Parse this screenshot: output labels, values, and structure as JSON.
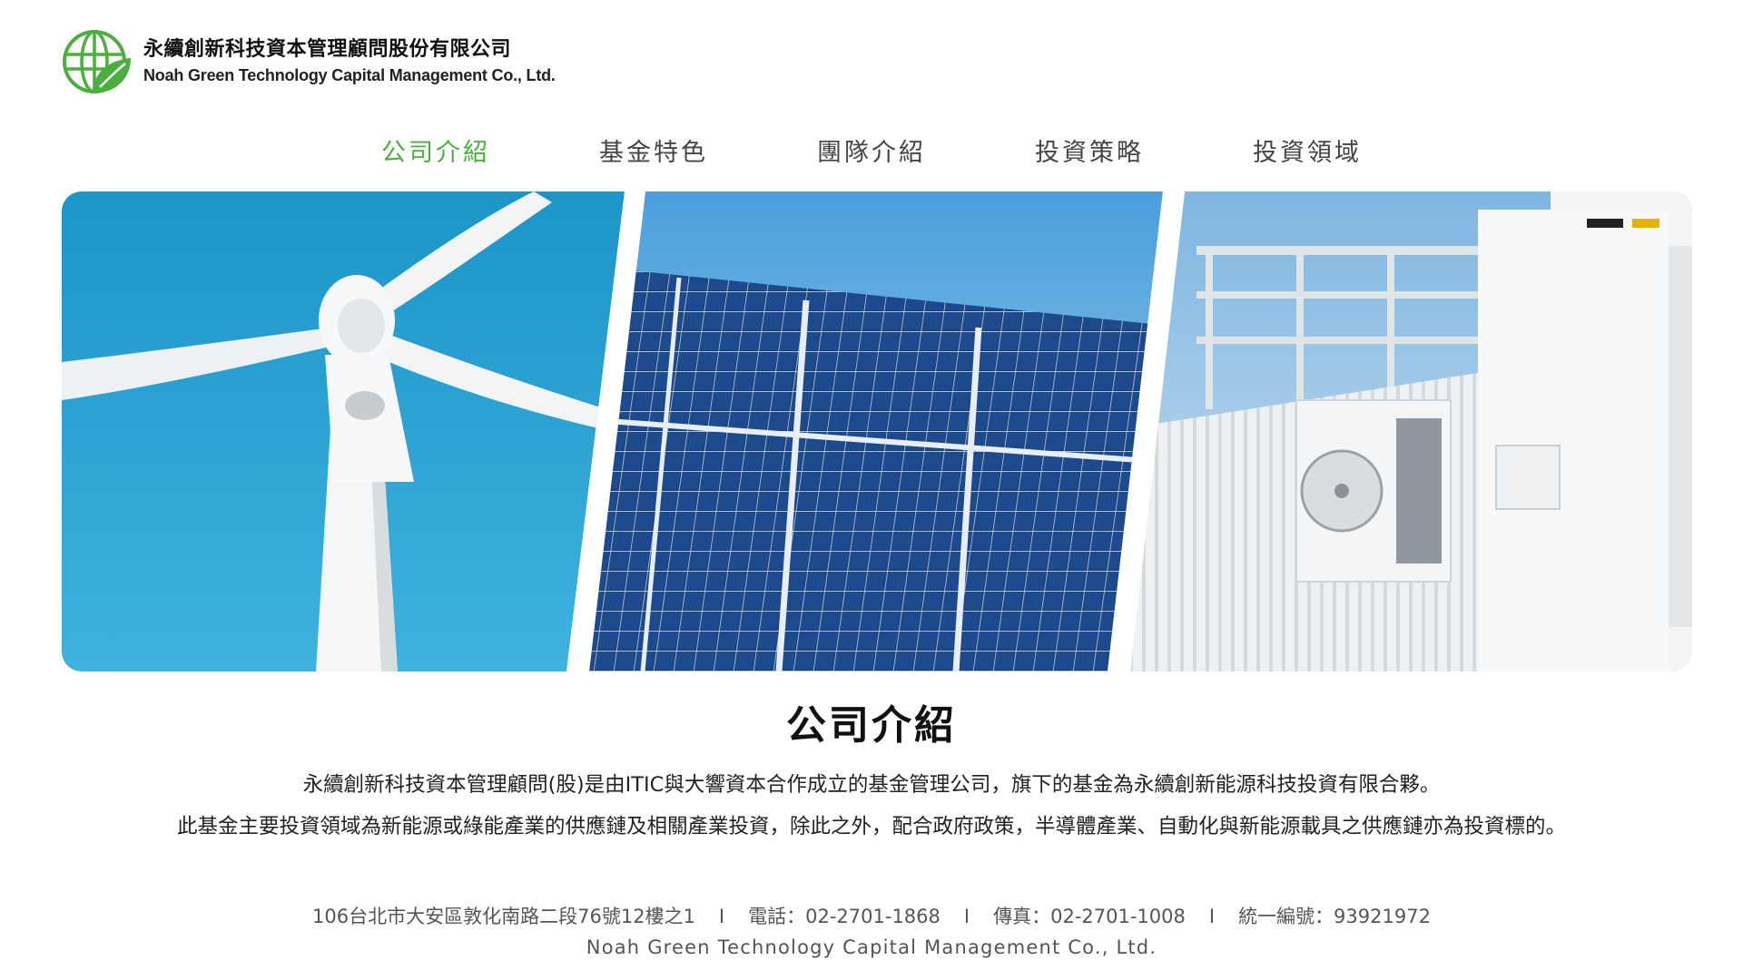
{
  "brand": {
    "name_cn": "永續創新科技資本管理顧問股份有限公司",
    "name_en": "Noah Green Technology Capital Management Co., Ltd.",
    "logo_icon": "globe-leaf-icon",
    "accent_color": "#4cae3f"
  },
  "nav": {
    "items": [
      {
        "label": "公司介紹",
        "active": true
      },
      {
        "label": "基金特色",
        "active": false
      },
      {
        "label": "團隊介紹",
        "active": false
      },
      {
        "label": "投資策略",
        "active": false
      },
      {
        "label": "投資領域",
        "active": false
      }
    ]
  },
  "banner": {
    "panels": [
      "wind-turbine-image",
      "solar-panels-image",
      "energy-storage-container-image"
    ]
  },
  "main": {
    "title": "公司介紹",
    "paragraphs": [
      "永續創新科技資本管理顧問(股)是由ITIC與大響資本合作成立的基金管理公司，旗下的基金為永續創新能源科技投資有限合夥。",
      "此基金主要投資領域為新能源或綠能產業的供應鏈及相關產業投資，除此之外，配合政府政策，半導體產業、自動化與新能源載具之供應鏈亦為投資標的。"
    ]
  },
  "footer": {
    "address": "106台北市大安區敦化南路二段76號12樓之1",
    "phone": "電話：02-2701-1868",
    "fax": "傳真：02-2701-1008",
    "tax_id": "統一編號：93921972",
    "separator": "I",
    "company_en": "Noah Green Technology Capital Management Co., Ltd."
  }
}
